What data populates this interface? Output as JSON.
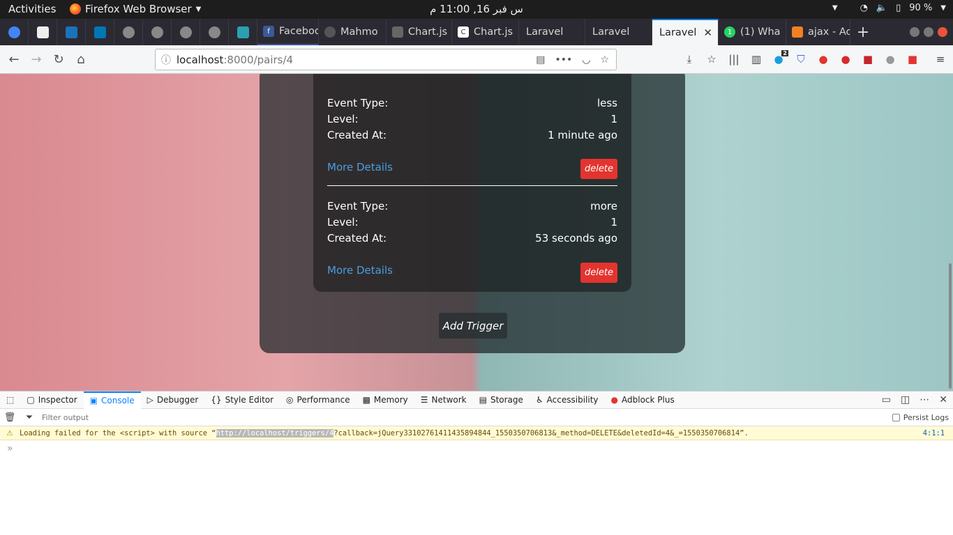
{
  "system": {
    "activities": "Activities",
    "app": "Firefox Web Browser",
    "clock": "س فبر 16, 11:00 م",
    "battery": "90 %"
  },
  "tabs": [
    {
      "label": "Faceboo",
      "icon_color": "#3b5998",
      "icon": "f"
    },
    {
      "label": "Mahmo",
      "icon_color": "#333333",
      "icon": "gh"
    },
    {
      "label": "Chart.js",
      "icon_color": "#555555",
      "icon": "cj"
    },
    {
      "label": "Chart.js",
      "icon_color": "#ffffff",
      "icon": "c"
    },
    {
      "label": "Laravel",
      "icon_color": "",
      "icon": ""
    },
    {
      "label": "Laravel",
      "icon_color": "",
      "icon": ""
    },
    {
      "label": "Laravel",
      "icon_color": "",
      "icon": "",
      "active": true
    },
    {
      "label": "(1) Wha",
      "icon_color": "#25d366",
      "icon": "1"
    },
    {
      "label": "ajax - Ac",
      "icon_color": "#f48024",
      "icon": "so"
    }
  ],
  "url": {
    "host": "localhost",
    "rest": ":8000/pairs/4"
  },
  "triggers": [
    {
      "event_type_label": "Event Type:",
      "event_type": "less",
      "level_label": "Level:",
      "level": "1",
      "created_label": "Created At:",
      "created": "1 minute ago",
      "more": "More Details",
      "delete": "delete"
    },
    {
      "event_type_label": "Event Type:",
      "event_type": "more",
      "level_label": "Level:",
      "level": "1",
      "created_label": "Created At:",
      "created": "53 seconds ago",
      "more": "More Details",
      "delete": "delete"
    }
  ],
  "add_trigger": "Add Trigger",
  "devtools": {
    "tabs": [
      "Inspector",
      "Console",
      "Debugger",
      "Style Editor",
      "Performance",
      "Memory",
      "Network",
      "Storage",
      "Accessibility",
      "Adblock Plus"
    ],
    "filter_placeholder": "Filter output",
    "persist": "Persist Logs",
    "warning_pre": "Loading failed for the <script> with source “",
    "warning_hl": "http://localhost/triggers/4",
    "warning_post": "?callback=jQuery33102761411435894844_1550350706813&_method=DELETE&deletedId=4&_=1550350706814”.",
    "warning_loc": "4:1:1",
    "prompt": "»"
  },
  "badge_count": "2"
}
